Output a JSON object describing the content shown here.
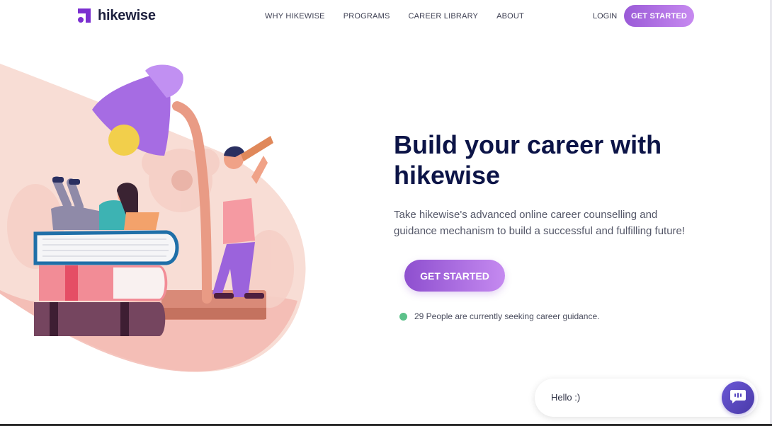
{
  "brand": {
    "name": "hikewise",
    "accent": "#9a5ad7",
    "navy": "#0c1447"
  },
  "nav": {
    "items": [
      "WHY HIKEWISE",
      "PROGRAMS",
      "CAREER LIBRARY",
      "ABOUT"
    ],
    "login": "LOGIN",
    "cta": "GET STARTED"
  },
  "hero": {
    "title": "Build your career with hikewise",
    "description": "Take hikewise's advanced online career counselling and guidance mechanism to build a successful and fulfilling future!",
    "cta": "GET STARTED",
    "status": "29 People are currently seeking career guidance.",
    "status_color": "#5cc18a"
  },
  "chat": {
    "message": "Hello :)",
    "icon": "chat-bubble-icon"
  },
  "illustration": {
    "icon": "career-illustration"
  }
}
